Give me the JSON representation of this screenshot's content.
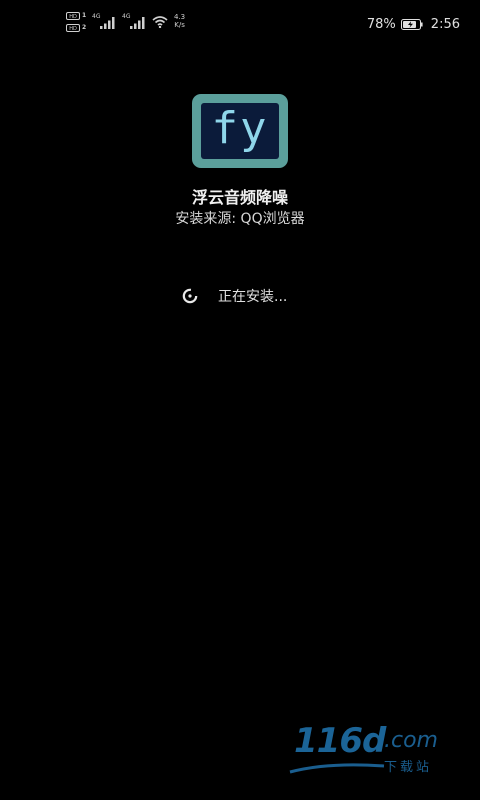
{
  "status_bar": {
    "sim1": {
      "hd": "HD",
      "slot": "1",
      "network": "4G"
    },
    "sim2": {
      "hd": "HD",
      "slot": "2",
      "network": "4G"
    },
    "speed_value": "4.3",
    "speed_unit": "K/s",
    "battery_percent": "78%",
    "time": "2:56",
    "icons": [
      "hd-badge",
      "signal-icon",
      "wifi-icon",
      "battery-charging-icon"
    ]
  },
  "app": {
    "icon_text": "fy",
    "name": "浮云音频降噪",
    "source": "安装来源:  QQ浏览器"
  },
  "install": {
    "status": "正在安装...",
    "icon": "loading-spinner-icon"
  },
  "watermark": {
    "main": "116d",
    "suffix": ".com",
    "sub": "下载站"
  },
  "colors": {
    "background": "#000000",
    "icon_frame": "#5b9f9b",
    "icon_bg": "#0b1b3a",
    "icon_text": "#8fd6ea",
    "watermark": "#1f6fa8"
  }
}
